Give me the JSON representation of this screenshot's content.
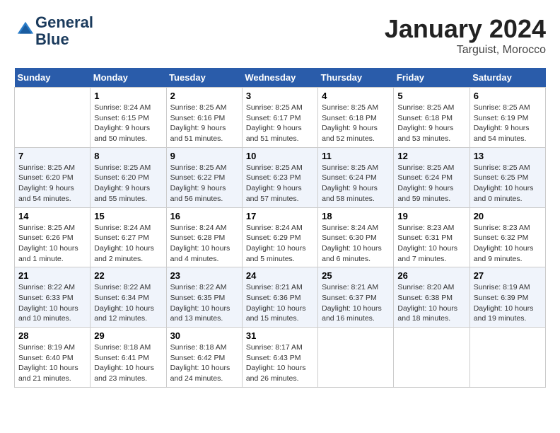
{
  "header": {
    "logo_line1": "General",
    "logo_line2": "Blue",
    "month_title": "January 2024",
    "location": "Targuist, Morocco"
  },
  "weekdays": [
    "Sunday",
    "Monday",
    "Tuesday",
    "Wednesday",
    "Thursday",
    "Friday",
    "Saturday"
  ],
  "weeks": [
    [
      {
        "num": "",
        "sunrise": "",
        "sunset": "",
        "daylight": ""
      },
      {
        "num": "1",
        "sunrise": "Sunrise: 8:24 AM",
        "sunset": "Sunset: 6:15 PM",
        "daylight": "Daylight: 9 hours and 50 minutes."
      },
      {
        "num": "2",
        "sunrise": "Sunrise: 8:25 AM",
        "sunset": "Sunset: 6:16 PM",
        "daylight": "Daylight: 9 hours and 51 minutes."
      },
      {
        "num": "3",
        "sunrise": "Sunrise: 8:25 AM",
        "sunset": "Sunset: 6:17 PM",
        "daylight": "Daylight: 9 hours and 51 minutes."
      },
      {
        "num": "4",
        "sunrise": "Sunrise: 8:25 AM",
        "sunset": "Sunset: 6:18 PM",
        "daylight": "Daylight: 9 hours and 52 minutes."
      },
      {
        "num": "5",
        "sunrise": "Sunrise: 8:25 AM",
        "sunset": "Sunset: 6:18 PM",
        "daylight": "Daylight: 9 hours and 53 minutes."
      },
      {
        "num": "6",
        "sunrise": "Sunrise: 8:25 AM",
        "sunset": "Sunset: 6:19 PM",
        "daylight": "Daylight: 9 hours and 54 minutes."
      }
    ],
    [
      {
        "num": "7",
        "sunrise": "Sunrise: 8:25 AM",
        "sunset": "Sunset: 6:20 PM",
        "daylight": "Daylight: 9 hours and 54 minutes."
      },
      {
        "num": "8",
        "sunrise": "Sunrise: 8:25 AM",
        "sunset": "Sunset: 6:20 PM",
        "daylight": "Daylight: 9 hours and 55 minutes."
      },
      {
        "num": "9",
        "sunrise": "Sunrise: 8:25 AM",
        "sunset": "Sunset: 6:22 PM",
        "daylight": "Daylight: 9 hours and 56 minutes."
      },
      {
        "num": "10",
        "sunrise": "Sunrise: 8:25 AM",
        "sunset": "Sunset: 6:23 PM",
        "daylight": "Daylight: 9 hours and 57 minutes."
      },
      {
        "num": "11",
        "sunrise": "Sunrise: 8:25 AM",
        "sunset": "Sunset: 6:24 PM",
        "daylight": "Daylight: 9 hours and 58 minutes."
      },
      {
        "num": "12",
        "sunrise": "Sunrise: 8:25 AM",
        "sunset": "Sunset: 6:24 PM",
        "daylight": "Daylight: 9 hours and 59 minutes."
      },
      {
        "num": "13",
        "sunrise": "Sunrise: 8:25 AM",
        "sunset": "Sunset: 6:25 PM",
        "daylight": "Daylight: 10 hours and 0 minutes."
      }
    ],
    [
      {
        "num": "14",
        "sunrise": "Sunrise: 8:25 AM",
        "sunset": "Sunset: 6:26 PM",
        "daylight": "Daylight: 10 hours and 1 minute."
      },
      {
        "num": "15",
        "sunrise": "Sunrise: 8:24 AM",
        "sunset": "Sunset: 6:27 PM",
        "daylight": "Daylight: 10 hours and 2 minutes."
      },
      {
        "num": "16",
        "sunrise": "Sunrise: 8:24 AM",
        "sunset": "Sunset: 6:28 PM",
        "daylight": "Daylight: 10 hours and 4 minutes."
      },
      {
        "num": "17",
        "sunrise": "Sunrise: 8:24 AM",
        "sunset": "Sunset: 6:29 PM",
        "daylight": "Daylight: 10 hours and 5 minutes."
      },
      {
        "num": "18",
        "sunrise": "Sunrise: 8:24 AM",
        "sunset": "Sunset: 6:30 PM",
        "daylight": "Daylight: 10 hours and 6 minutes."
      },
      {
        "num": "19",
        "sunrise": "Sunrise: 8:23 AM",
        "sunset": "Sunset: 6:31 PM",
        "daylight": "Daylight: 10 hours and 7 minutes."
      },
      {
        "num": "20",
        "sunrise": "Sunrise: 8:23 AM",
        "sunset": "Sunset: 6:32 PM",
        "daylight": "Daylight: 10 hours and 9 minutes."
      }
    ],
    [
      {
        "num": "21",
        "sunrise": "Sunrise: 8:22 AM",
        "sunset": "Sunset: 6:33 PM",
        "daylight": "Daylight: 10 hours and 10 minutes."
      },
      {
        "num": "22",
        "sunrise": "Sunrise: 8:22 AM",
        "sunset": "Sunset: 6:34 PM",
        "daylight": "Daylight: 10 hours and 12 minutes."
      },
      {
        "num": "23",
        "sunrise": "Sunrise: 8:22 AM",
        "sunset": "Sunset: 6:35 PM",
        "daylight": "Daylight: 10 hours and 13 minutes."
      },
      {
        "num": "24",
        "sunrise": "Sunrise: 8:21 AM",
        "sunset": "Sunset: 6:36 PM",
        "daylight": "Daylight: 10 hours and 15 minutes."
      },
      {
        "num": "25",
        "sunrise": "Sunrise: 8:21 AM",
        "sunset": "Sunset: 6:37 PM",
        "daylight": "Daylight: 10 hours and 16 minutes."
      },
      {
        "num": "26",
        "sunrise": "Sunrise: 8:20 AM",
        "sunset": "Sunset: 6:38 PM",
        "daylight": "Daylight: 10 hours and 18 minutes."
      },
      {
        "num": "27",
        "sunrise": "Sunrise: 8:19 AM",
        "sunset": "Sunset: 6:39 PM",
        "daylight": "Daylight: 10 hours and 19 minutes."
      }
    ],
    [
      {
        "num": "28",
        "sunrise": "Sunrise: 8:19 AM",
        "sunset": "Sunset: 6:40 PM",
        "daylight": "Daylight: 10 hours and 21 minutes."
      },
      {
        "num": "29",
        "sunrise": "Sunrise: 8:18 AM",
        "sunset": "Sunset: 6:41 PM",
        "daylight": "Daylight: 10 hours and 23 minutes."
      },
      {
        "num": "30",
        "sunrise": "Sunrise: 8:18 AM",
        "sunset": "Sunset: 6:42 PM",
        "daylight": "Daylight: 10 hours and 24 minutes."
      },
      {
        "num": "31",
        "sunrise": "Sunrise: 8:17 AM",
        "sunset": "Sunset: 6:43 PM",
        "daylight": "Daylight: 10 hours and 26 minutes."
      },
      {
        "num": "",
        "sunrise": "",
        "sunset": "",
        "daylight": ""
      },
      {
        "num": "",
        "sunrise": "",
        "sunset": "",
        "daylight": ""
      },
      {
        "num": "",
        "sunrise": "",
        "sunset": "",
        "daylight": ""
      }
    ]
  ]
}
